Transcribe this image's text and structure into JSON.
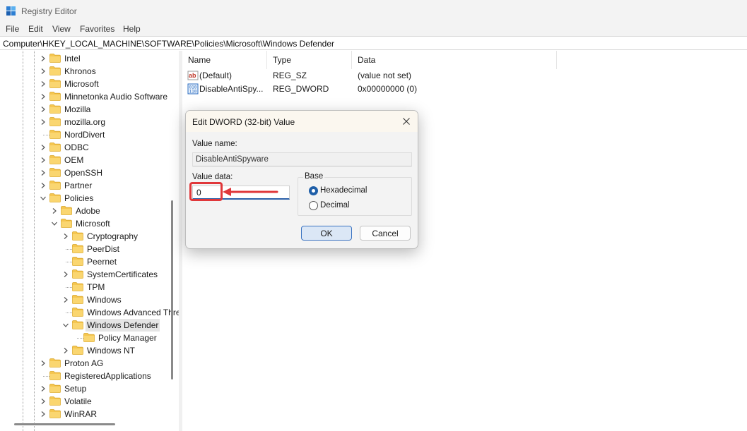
{
  "window": {
    "title": "Registry Editor"
  },
  "menu": [
    "File",
    "Edit",
    "View",
    "Favorites",
    "Help"
  ],
  "address": {
    "path": "Computer\\HKEY_LOCAL_MACHINE\\SOFTWARE\\Policies\\Microsoft\\Windows Defender"
  },
  "tree": [
    {
      "label": "Intel",
      "level": 0,
      "chevron": "right"
    },
    {
      "label": "Khronos",
      "level": 0,
      "chevron": "right"
    },
    {
      "label": "Microsoft",
      "level": 0,
      "chevron": "right"
    },
    {
      "label": "Minnetonka Audio Software",
      "level": 0,
      "chevron": "right"
    },
    {
      "label": "Mozilla",
      "level": 0,
      "chevron": "right"
    },
    {
      "label": "mozilla.org",
      "level": 0,
      "chevron": "right"
    },
    {
      "label": "NordDivert",
      "level": 0,
      "chevron": "none"
    },
    {
      "label": "ODBC",
      "level": 0,
      "chevron": "right"
    },
    {
      "label": "OEM",
      "level": 0,
      "chevron": "right"
    },
    {
      "label": "OpenSSH",
      "level": 0,
      "chevron": "right"
    },
    {
      "label": "Partner",
      "level": 0,
      "chevron": "right"
    },
    {
      "label": "Policies",
      "level": 0,
      "chevron": "down"
    },
    {
      "label": "Adobe",
      "level": 1,
      "chevron": "right"
    },
    {
      "label": "Microsoft",
      "level": 1,
      "chevron": "down"
    },
    {
      "label": "Cryptography",
      "level": 2,
      "chevron": "right"
    },
    {
      "label": "PeerDist",
      "level": 2,
      "chevron": "none"
    },
    {
      "label": "Peernet",
      "level": 2,
      "chevron": "none"
    },
    {
      "label": "SystemCertificates",
      "level": 2,
      "chevron": "right"
    },
    {
      "label": "TPM",
      "level": 2,
      "chevron": "none"
    },
    {
      "label": "Windows",
      "level": 2,
      "chevron": "right"
    },
    {
      "label": "Windows Advanced Threat Protection",
      "level": 2,
      "chevron": "none"
    },
    {
      "label": "Windows Defender",
      "level": 2,
      "chevron": "down",
      "selected": true
    },
    {
      "label": "Policy Manager",
      "level": 3,
      "chevron": "none"
    },
    {
      "label": "Windows NT",
      "level": 2,
      "chevron": "right"
    },
    {
      "label": "Proton AG",
      "level": 0,
      "chevron": "right"
    },
    {
      "label": "RegisteredApplications",
      "level": 0,
      "chevron": "none"
    },
    {
      "label": "Setup",
      "level": 0,
      "chevron": "right"
    },
    {
      "label": "Volatile",
      "level": 0,
      "chevron": "right"
    },
    {
      "label": "WinRAR",
      "level": 0,
      "chevron": "right"
    }
  ],
  "list": {
    "columns": [
      "Name",
      "Type",
      "Data"
    ],
    "rows": [
      {
        "icon": "string-value-icon",
        "name": "(Default)",
        "type": "REG_SZ",
        "data": "(value not set)"
      },
      {
        "icon": "binary-value-icon",
        "name": "DisableAntiSpy...",
        "type": "REG_DWORD",
        "data": "0x00000000 (0)"
      }
    ]
  },
  "dialog": {
    "title": "Edit DWORD (32-bit) Value",
    "value_name_label": "Value name:",
    "value_name": "DisableAntiSpyware",
    "value_data_label": "Value data:",
    "value_data": "0",
    "base_label": "Base",
    "base_options": [
      {
        "label": "Hexadecimal",
        "checked": true
      },
      {
        "label": "Decimal",
        "checked": false
      }
    ],
    "ok_label": "OK",
    "cancel_label": "Cancel"
  },
  "colors": {
    "accent": "#1f5fa8",
    "callout": "#e0373a",
    "folder": "#f5c650"
  }
}
